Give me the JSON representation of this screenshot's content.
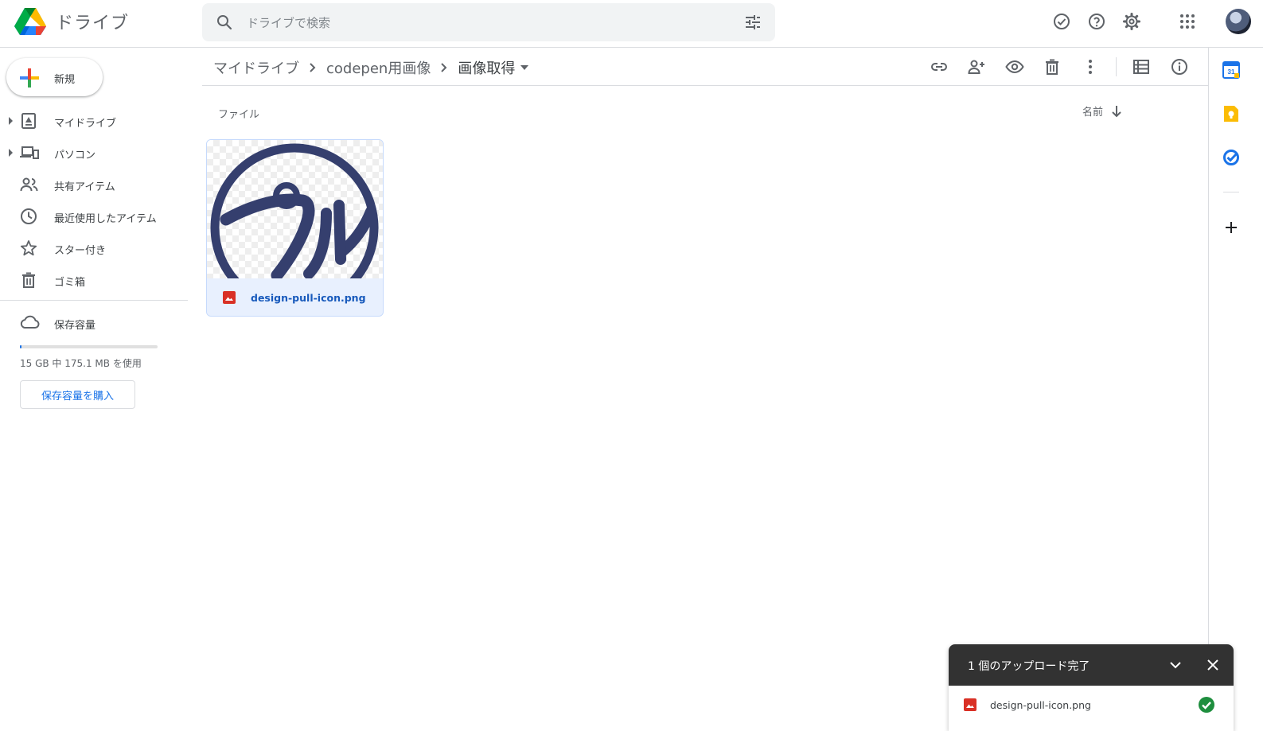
{
  "app": {
    "title": "ドライブ"
  },
  "search": {
    "placeholder": "ドライブで検索"
  },
  "header": {
    "icons": [
      "status-check-icon",
      "help-icon",
      "settings-icon",
      "apps-grid-icon",
      "avatar"
    ]
  },
  "sidebar": {
    "new_label": "新規",
    "items": [
      {
        "label": "マイドライブ",
        "icon": "my-drive-icon",
        "expandable": true
      },
      {
        "label": "パソコン",
        "icon": "computers-icon",
        "expandable": true
      },
      {
        "label": "共有アイテム",
        "icon": "shared-icon",
        "expandable": false
      },
      {
        "label": "最近使用したアイテム",
        "icon": "clock-icon",
        "expandable": false
      },
      {
        "label": "スター付き",
        "icon": "star-icon",
        "expandable": false
      },
      {
        "label": "ゴミ箱",
        "icon": "trash-icon",
        "expandable": false
      }
    ],
    "storage": {
      "label": "保存容量",
      "usage_text": "15 GB 中 175.1 MB を使用",
      "used_fraction": 0.0117,
      "buy_label": "保存容量を購入"
    }
  },
  "breadcrumb": {
    "items": [
      "マイドライブ",
      "codepen用画像",
      "画像取得"
    ]
  },
  "toolbar": {
    "icons": [
      "link-icon",
      "share-icon",
      "preview-icon",
      "trash-icon",
      "more-vert-icon",
      "list-view-icon",
      "info-icon"
    ]
  },
  "content": {
    "section_title": "ファイル",
    "sort_label": "名前",
    "files": [
      {
        "name": "design-pull-icon.png",
        "thumbnail_text": "プル",
        "selected": true
      }
    ]
  },
  "side_panel": {
    "icons": [
      "calendar-icon",
      "keep-icon",
      "tasks-icon",
      "add-icon"
    ],
    "calendar_day": "31"
  },
  "upload_toast": {
    "title": "1 個のアップロード完了",
    "items": [
      {
        "name": "design-pull-icon.png",
        "status": "complete"
      }
    ]
  },
  "colors": {
    "accent": "#1a73e8",
    "file_selected_bg": "#e8f0fe",
    "logo_stroke": "#353f6e",
    "toast_bg": "#323232",
    "success": "#1e8e3e"
  }
}
